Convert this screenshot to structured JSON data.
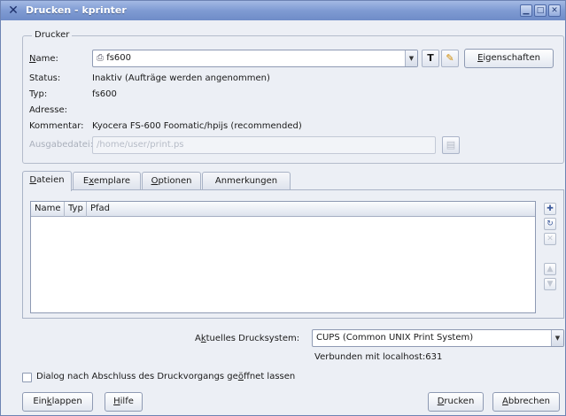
{
  "window": {
    "title": "Drucken - kprinter",
    "app_icon": "x-icon",
    "buttons": [
      "minimize-icon",
      "maximize-icon",
      "close-icon"
    ]
  },
  "printer_group": {
    "label": "Drucker",
    "name_label": "Name:",
    "name_value": "fs600",
    "properties_button": "Eigenschaften",
    "status_label": "Status:",
    "status_value": "Inaktiv (Aufträge werden angenommen)",
    "type_label": "Typ:",
    "type_value": "fs600",
    "address_label": "Adresse:",
    "address_value": "",
    "comment_label": "Kommentar:",
    "comment_value": "Kyocera FS-600 Foomatic/hpijs (recommended)",
    "output_file_label": "Ausgabedatei:",
    "output_file_value": "/home/user/print.ps"
  },
  "tabs": [
    "Dateien",
    "Exemplare",
    "Optionen",
    "Anmerkungen"
  ],
  "files_table": {
    "columns": [
      "Name",
      "Typ",
      "Pfad"
    ],
    "rows": []
  },
  "print_system": {
    "label": "Aktuelles Drucksystem:",
    "value": "CUPS (Common UNIX Print System)",
    "connection": "Verbunden mit localhost:631"
  },
  "keep_open_checkbox": {
    "label": "Dialog nach Abschluss des Druckvorgangs geöffnet lassen",
    "checked": false
  },
  "footer": {
    "collapse_button": "Einklappen",
    "help_button": "Hilfe",
    "print_button": "Drucken",
    "cancel_button": "Abbrechen"
  },
  "colors": {
    "titlebar": "#7f9bd3",
    "background": "#eceff5",
    "border": "#8e9ab3"
  }
}
